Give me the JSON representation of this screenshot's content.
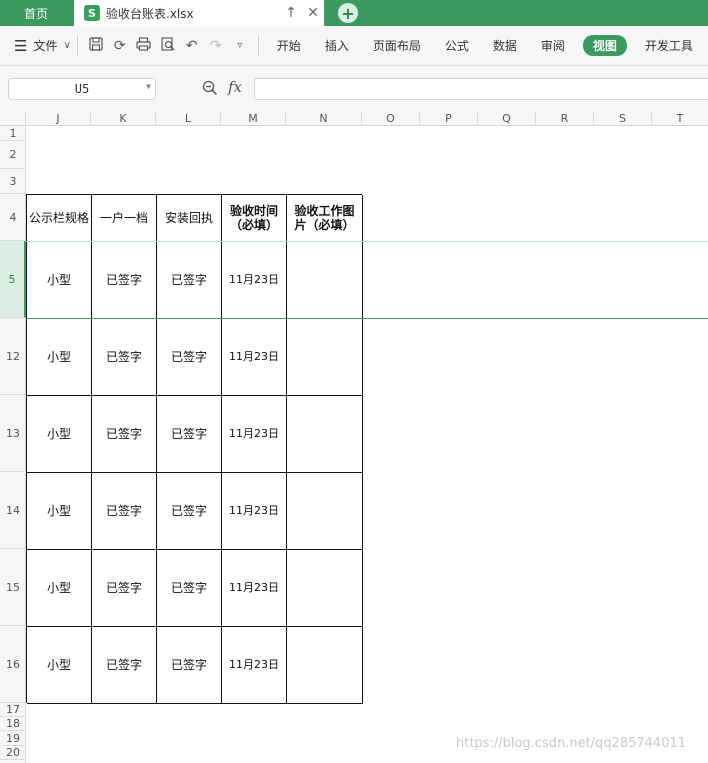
{
  "tabs": {
    "home_label": "首页",
    "file_icon": "S",
    "file_name": "验收台账表.xlsx",
    "add_label": "+"
  },
  "ribbon": {
    "file_menu": "文件",
    "tabs": [
      "开始",
      "插入",
      "页面布局",
      "公式",
      "数据",
      "审阅",
      "视图",
      "开发工具"
    ],
    "active_tab": "视图"
  },
  "formula_bar": {
    "cell_ref": "U5",
    "fx_label": "fx",
    "value": ""
  },
  "columns": [
    "J",
    "K",
    "L",
    "M",
    "N",
    "O",
    "P",
    "Q",
    "R",
    "S",
    "T"
  ],
  "rows": [
    "1",
    "2",
    "3",
    "4",
    "5",
    "12",
    "13",
    "14",
    "15",
    "16",
    "17",
    "18",
    "19",
    "20"
  ],
  "selected_row": "5",
  "table": {
    "headers": [
      "公示栏规格",
      "一户一档",
      "安装回执",
      "验收时间\n（必填）",
      "验收工作图\n片（必填）"
    ],
    "rows": [
      [
        "小型",
        "已签字",
        "已签字",
        "11月23日",
        ""
      ],
      [
        "小型",
        "已签字",
        "已签字",
        "11月23日",
        ""
      ],
      [
        "小型",
        "已签字",
        "已签字",
        "11月23日",
        ""
      ],
      [
        "小型",
        "已签字",
        "已签字",
        "11月23日",
        ""
      ],
      [
        "小型",
        "已签字",
        "已签字",
        "11月23日",
        ""
      ],
      [
        "小型",
        "已签字",
        "已签字",
        "11月23日",
        ""
      ]
    ]
  },
  "watermark": "https://blog.csdn.net/qq285744011"
}
